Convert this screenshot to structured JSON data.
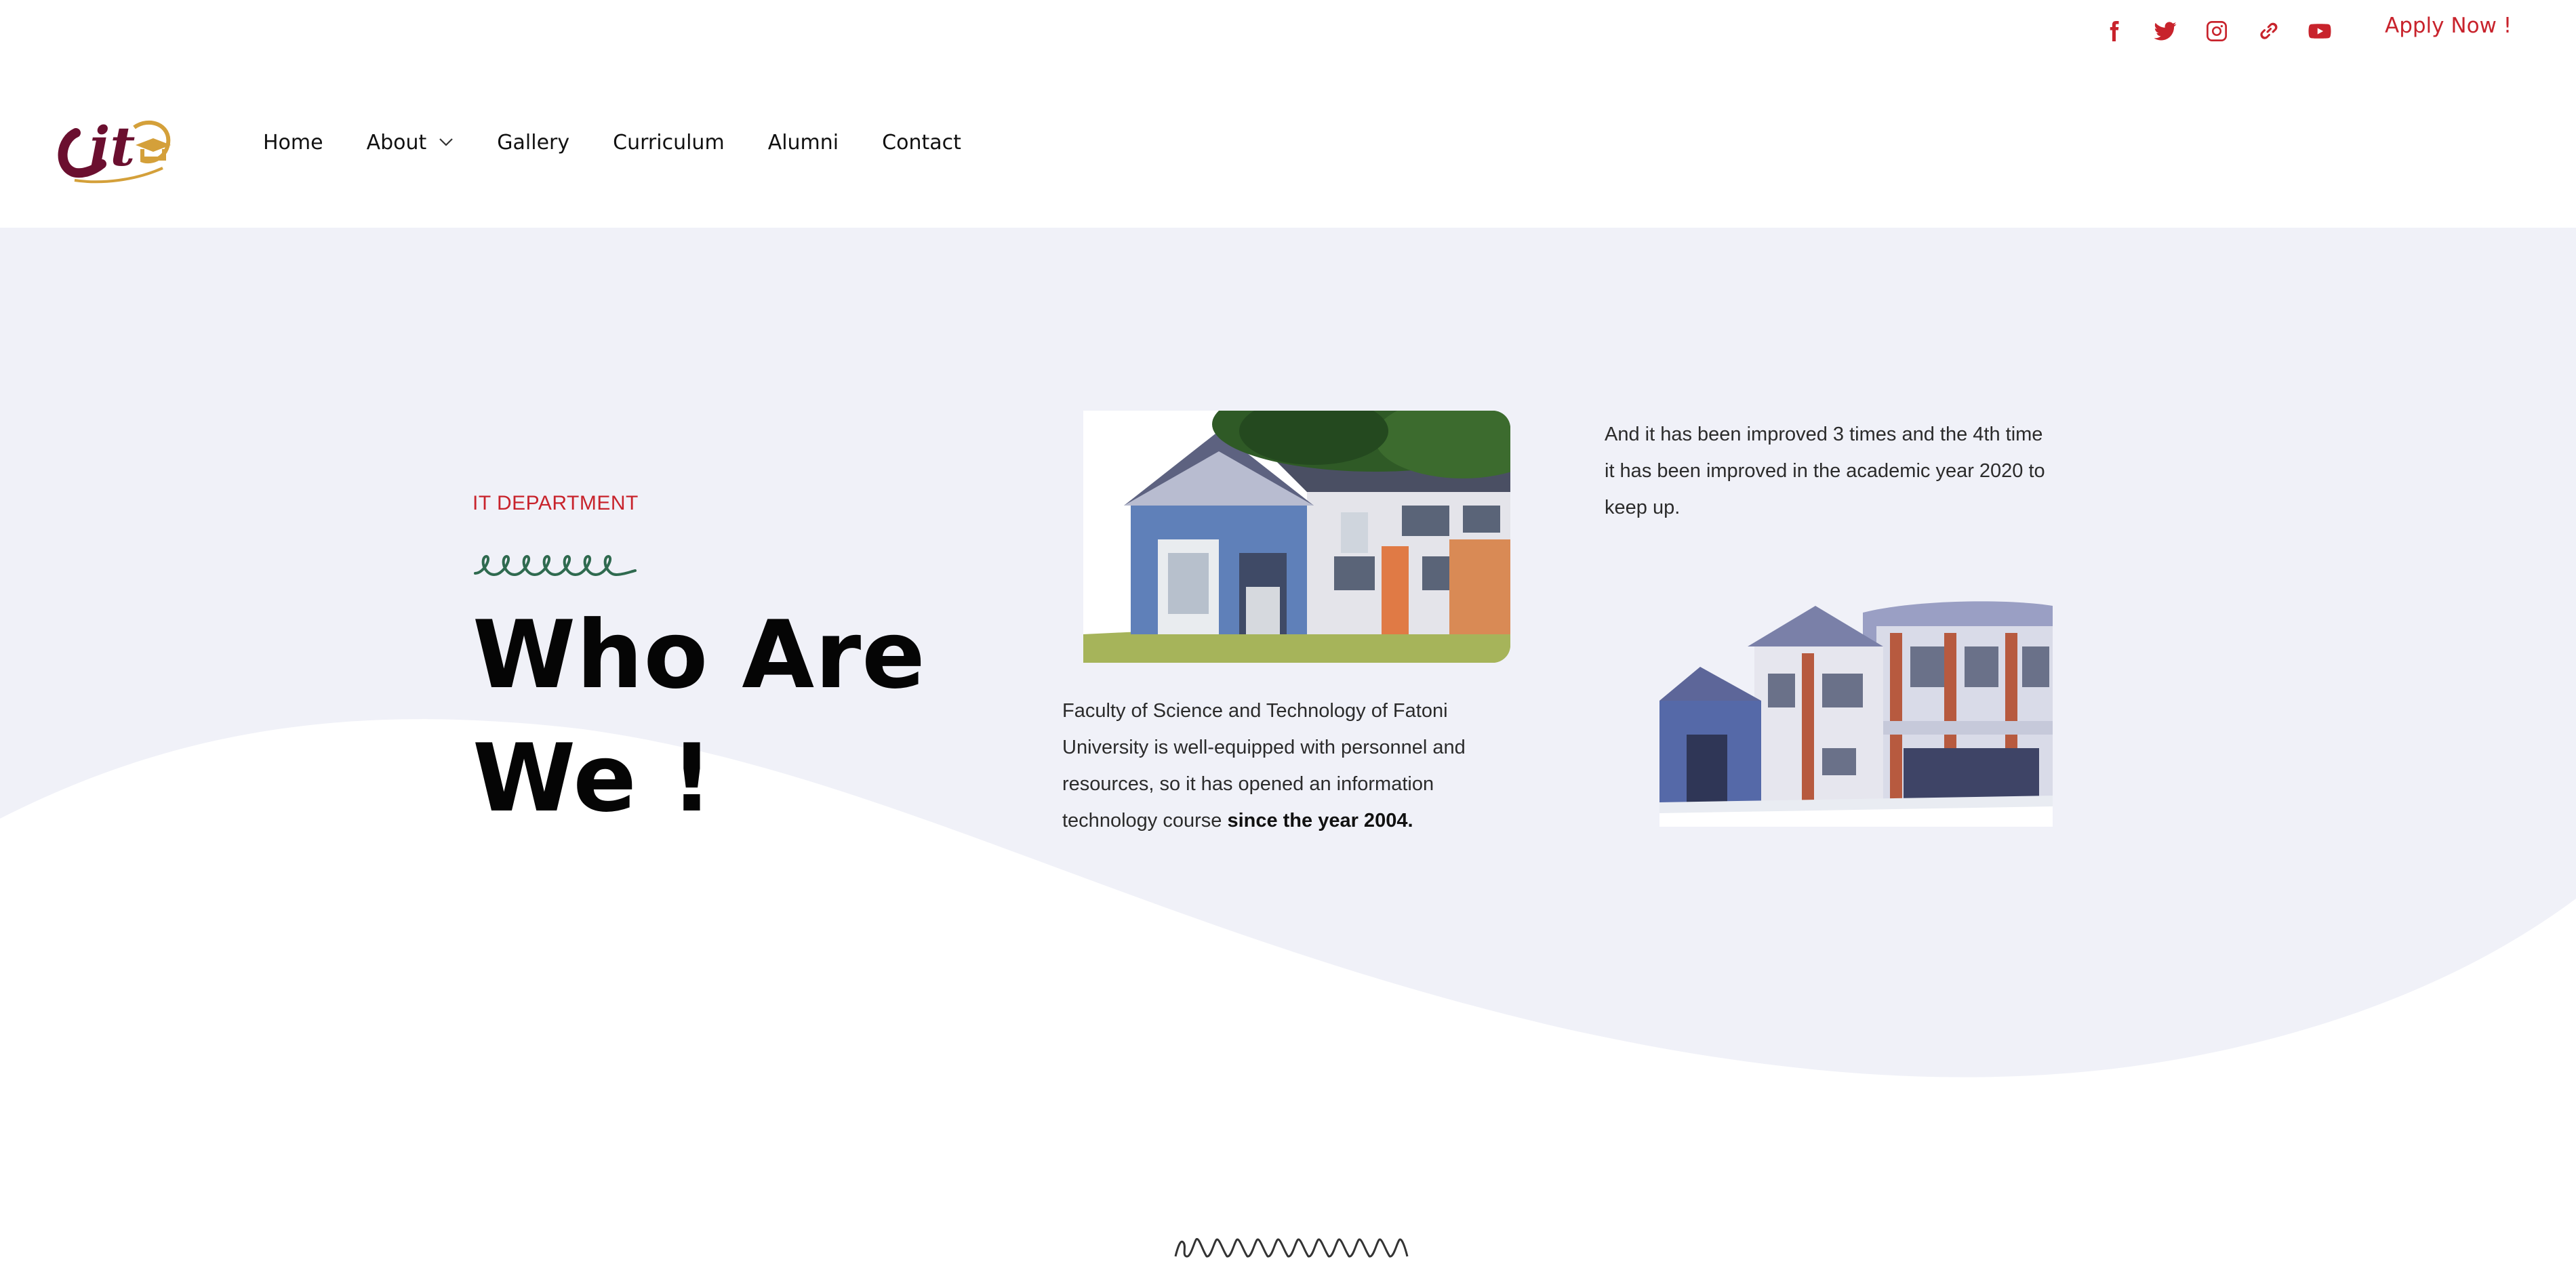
{
  "topbar": {
    "social": [
      {
        "name": "facebook-icon"
      },
      {
        "name": "twitter-icon"
      },
      {
        "name": "instagram-icon"
      },
      {
        "name": "link-icon"
      },
      {
        "name": "youtube-icon"
      }
    ],
    "apply_label": "Apply Now !"
  },
  "header": {
    "logo_text": "it",
    "nav": {
      "home": "Home",
      "about": "About",
      "gallery": "Gallery",
      "curriculum": "Curriculum",
      "alumni": "Alumni",
      "contact": "Contact"
    }
  },
  "hero": {
    "eyebrow": "IT DEPARTMENT",
    "headline_line1": "Who Are",
    "headline_line2": "We !",
    "desc1_text": "Faculty of Science and Technology of Fatoni University is well-equipped with personnel and resources, so it has opened an information technology course ",
    "desc1_bold": "since the year 2004.",
    "desc2": "And it has been improved 3 times and the 4th time it has been improved in the academic year 2020 to keep up."
  },
  "colors": {
    "accent": "#c8232c",
    "hero_bg": "#f0f1f8",
    "logo_maroon": "#6b0f2f",
    "logo_gold": "#d4a03a",
    "squiggle": "#2f6a4f"
  }
}
